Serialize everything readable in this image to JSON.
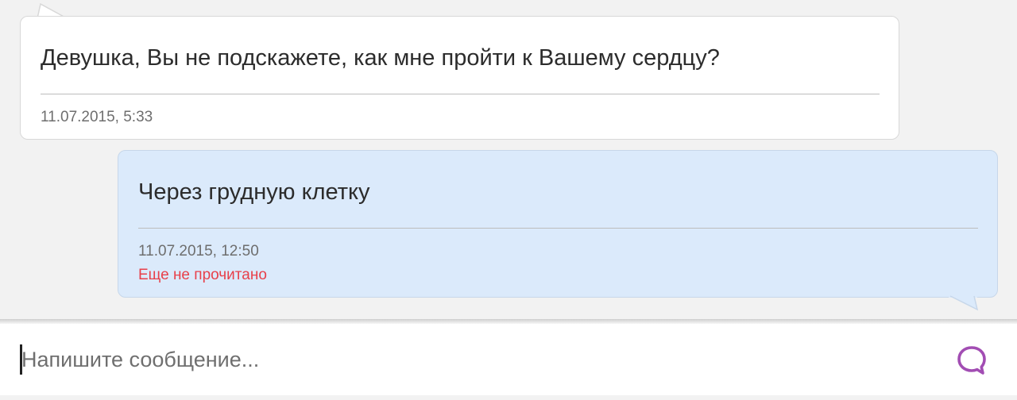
{
  "messages": [
    {
      "direction": "incoming",
      "text": "Девушка, Вы не подскажете, как мне пройти к Вашему сердцу?",
      "timestamp": "11.07.2015, 5:33"
    },
    {
      "direction": "outgoing",
      "text": "Через грудную клетку",
      "timestamp": "11.07.2015, 12:50",
      "status": "Еще не прочитано"
    }
  ],
  "composer": {
    "placeholder": "Напишите сообщение...",
    "value": "",
    "send_icon": "speech-bubble-icon"
  },
  "colors": {
    "incoming_bubble": "#ffffff",
    "outgoing_bubble": "#dbeafb",
    "unread_status": "#e8404a",
    "send_icon": "#a24db3",
    "background": "#f2f2f2"
  }
}
